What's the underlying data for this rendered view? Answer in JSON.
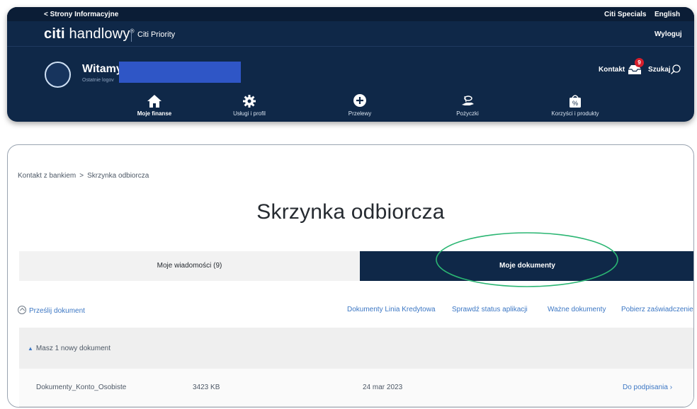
{
  "utility_bar": {
    "back_link": "< Strony Informacyjne",
    "specials": "Citi Specials",
    "language": "English"
  },
  "brand": {
    "logo_citi": "citi",
    "logo_handlowy": " handlowy",
    "logo_reg": "®",
    "priority": "Citi Priority",
    "logout": "Wyloguj"
  },
  "user": {
    "welcome": "Witamy,",
    "last_login": "Ostatnie logov"
  },
  "header_actions": {
    "contact": "Kontakt",
    "notification_count": "9",
    "search": "Szukaj"
  },
  "nav": [
    {
      "label": "Moje finanse",
      "icon": "home-icon",
      "active": true
    },
    {
      "label": "Usługi i profil",
      "icon": "gear-icon",
      "active": false
    },
    {
      "label": "Przelewy",
      "icon": "plus-circle-icon",
      "active": false
    },
    {
      "label": "Pożyczki",
      "icon": "money-hand-icon",
      "active": false
    },
    {
      "label": "Korzyści i produkty",
      "icon": "percent-bag-icon",
      "active": false
    }
  ],
  "breadcrumb": {
    "parent": "Kontakt z bankiem",
    "separator": ">",
    "current": "Skrzynka odbiorcza"
  },
  "page": {
    "title": "Skrzynka odbiorcza"
  },
  "tabs": {
    "messages": "Moje wiadomości (9)",
    "documents": "Moje dokumenty"
  },
  "actions": {
    "upload": "Prześlij dokument",
    "links": [
      "Dokumenty Linia Kredytowa",
      "Sprawdź status aplikacji",
      "Ważne dokumenty",
      "Pobierz zaświadczenie"
    ]
  },
  "documents_section": {
    "title": "Masz 1 nowy dokument",
    "rows": [
      {
        "name": "Dokumenty_Konto_Osobiste",
        "size": "3423 KB",
        "date": "24 mar 2023",
        "action": "Do podpisania ›"
      }
    ]
  },
  "colors": {
    "navy": "#0f2848",
    "link_blue": "#3c77c4",
    "highlight_green": "#2bb673",
    "badge_red": "#d61e2b"
  }
}
